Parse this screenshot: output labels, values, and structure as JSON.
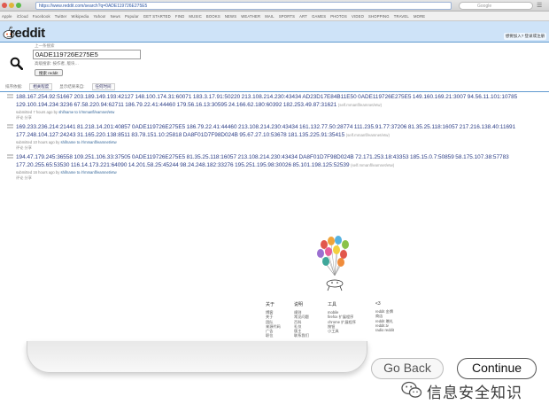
{
  "browser": {
    "url": "https://www.reddit.com/search?q=0ADE119726E275E5",
    "search_placeholder": "Google",
    "bookmarks": [
      "Apple",
      "iCloud",
      "Facebook",
      "Twitter",
      "Wikipedia",
      "Yahoo!",
      "News",
      "Popular",
      "GET STARTED",
      "FIND",
      "MUSIC",
      "BOOKS",
      "NEWS",
      "WEATHER",
      "MAIL",
      "SPORTS",
      "ART",
      "GAMES",
      "PHOTOS",
      "VIDEO",
      "SHOPPING",
      "TRAVEL",
      "MORE"
    ]
  },
  "reddit": {
    "logo_text": "reddit",
    "user_area": "想要加入? 登录或注册"
  },
  "search": {
    "label": "上一条搜索",
    "query": "0ADE119726E275E5",
    "options": "高级搜索: 按作者, 版块…",
    "button": "搜索 reddit"
  },
  "sort_bar": {
    "sort_label": "排序依据:",
    "sort_value": "相关程度",
    "time_label": "显示结果来自:",
    "time_value": "任何时间"
  },
  "results": [
    {
      "title": "188.167.254.92:51667 203.189.149.193:42127 148.100.174.31:60071 183.3.17.91:50220 213.108.214.230:43434 AD23D17E84B11E50 0ADE119726E275E5 149.160.169.21:3007 94.56.11.101:10785 129.100.194.234:3236 67.58.220.94:62711 186.79.22.41:44460 179.56.16.13:30595 24.166.62.180:60392 182.253.49.87:31621",
      "domain": "(self.mmanfl/eamnet/etw)",
      "meta_prefix": "submitted 7 hours ago by",
      "author": "shifname",
      "meta_suffix": "to /r/mmanfl/eamnet/etw",
      "links": "评论   分享"
    },
    {
      "title": "169.233.236.214:21441 81.218.14.201:40857 0ADE119726E275E5 186.79.22.41:44460 213.108.214.230:43434 161.132.77.50:28774 111.235.91.77:37206 81.35.25.118:16057 217.216.138.40:11691 177.248.104.127:24243 31.165.220.138:8511 83.78.151.10:25818 DA8F01D7F98D024B 95.67.27.10:53678 181.135.225.91:35415",
      "domain": "(self.mmanfl/eamnet/etw)",
      "meta_prefix": "submitted 10 hours ago by",
      "author": "shifname",
      "meta_suffix": "to /r/mmanfl/eamnet/etw",
      "links": "评论   分享"
    },
    {
      "title": "194.47.179.245:36558 109.251.106.33:37505 0ADE119726E275E5 81.35.25.118:16057 213.108.214.230:43434 DA8F01D7F98D024B 72.171.253.18:43353 185.15.0.7:50859 58.175.107.38:57783 177.20.255.65:53530 116.14.173.221:64090 14.201.58.25:45244 98.24.248.182:33276 195.251.195.98:30026 85.101.198.125:52539",
      "domain": "(self.mmanfl/eamnet/etw)",
      "meta_prefix": "submitted 16 hours ago by",
      "author": "shifname",
      "meta_suffix": "to /r/mmanfl/eamnet/etw",
      "links": "评论   分享"
    }
  ],
  "footer": {
    "columns": [
      {
        "head": "关于",
        "items": [
          "博客",
          "关于",
          "团队",
          "来源代码",
          "广告",
          "职位"
        ]
      },
      {
        "head": "说明",
        "items": [
          "规则",
          "常见问题",
          "百科",
          "礼仪",
          "版主",
          "联系我们"
        ]
      },
      {
        "head": "工具",
        "items": [
          "mobile",
          "firefox 扩展程序",
          "chrome 扩展程序",
          "按钮",
          "小工具"
        ]
      },
      {
        "head": "<3",
        "items": [
          "reddit 金牌",
          "商店",
          "reddit 赠礼",
          "reddit.tv",
          "radio reddit"
        ]
      }
    ]
  },
  "dialog_buttons": {
    "back": "Go Back",
    "continue": "Continue"
  },
  "watermark": {
    "text": "信息安全知识"
  }
}
